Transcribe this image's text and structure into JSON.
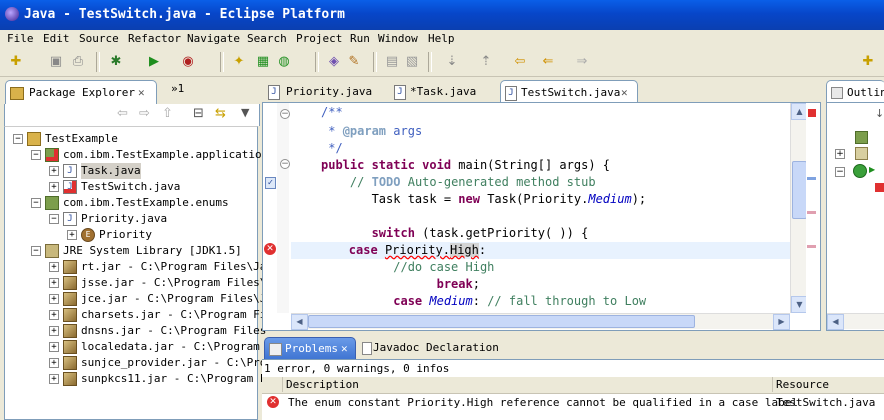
{
  "window": {
    "title": "Java - TestSwitch.java - Eclipse Platform"
  },
  "menu": [
    "File",
    "Edit",
    "Source",
    "Refactor",
    "Navigate",
    "Search",
    "Project",
    "Run",
    "Window",
    "Help"
  ],
  "package_explorer": {
    "tab_label": "Package Explorer",
    "hierarchy_tab": "»1",
    "tree": [
      {
        "label": "TestExample",
        "level": 0,
        "icon": "project-icon",
        "expanded": true
      },
      {
        "label": "com.ibm.TestExample.application",
        "level": 1,
        "icon": "package-error-icon",
        "expanded": true
      },
      {
        "label": "Task.java",
        "level": 2,
        "icon": "java-file-icon",
        "expanded": false
      },
      {
        "label": "TestSwitch.java",
        "level": 2,
        "icon": "java-file-error-icon",
        "expanded": false
      },
      {
        "label": "com.ibm.TestExample.enums",
        "level": 1,
        "icon": "package-icon",
        "expanded": true
      },
      {
        "label": "Priority.java",
        "level": 2,
        "icon": "java-file-icon",
        "expanded": true
      },
      {
        "label": "Priority",
        "level": 3,
        "icon": "enum-icon",
        "expanded": false
      },
      {
        "label": "JRE System Library [JDK1.5]",
        "level": 1,
        "icon": "library-icon",
        "expanded": true
      },
      {
        "label": "rt.jar - C:\\Program Files\\Ja",
        "level": 2,
        "icon": "jar-icon",
        "expanded": false
      },
      {
        "label": "jsse.jar - C:\\Program Files\\",
        "level": 2,
        "icon": "jar-icon",
        "expanded": false
      },
      {
        "label": "jce.jar - C:\\Program Files\\J",
        "level": 2,
        "icon": "jar-icon",
        "expanded": false
      },
      {
        "label": "charsets.jar - C:\\Program Fi",
        "level": 2,
        "icon": "jar-icon",
        "expanded": false
      },
      {
        "label": "dnsns.jar - C:\\Program Files",
        "level": 2,
        "icon": "jar-icon",
        "expanded": false
      },
      {
        "label": "localedata.jar - C:\\Program",
        "level": 2,
        "icon": "jar-icon",
        "expanded": false
      },
      {
        "label": "sunjce_provider.jar - C:\\Pro",
        "level": 2,
        "icon": "jar-icon",
        "expanded": false
      },
      {
        "label": "sunpkcs11.jar - C:\\Program F",
        "level": 2,
        "icon": "jar-icon",
        "expanded": false
      }
    ]
  },
  "editor": {
    "tabs": [
      {
        "label": "Priority.java",
        "active": false
      },
      {
        "label": "*Task.java",
        "active": false
      },
      {
        "label": "TestSwitch.java",
        "active": true
      }
    ]
  },
  "outline": {
    "tab_label": "Outlin"
  },
  "problems": {
    "tabs": [
      {
        "label": "Problems",
        "active": true
      },
      {
        "label": "Javadoc",
        "active": false
      },
      {
        "label": "Declaration",
        "active": false
      }
    ],
    "summary": "1 error, 0 warnings, 0 infos",
    "columns": {
      "description": "Description",
      "resource": "Resource"
    },
    "rows": [
      {
        "description": "The enum constant Priority.High reference cannot be qualified in a case label",
        "resource": "TestSwitch.java"
      }
    ]
  },
  "colors": {
    "title_bar": "#0746c9",
    "error": "#e03030",
    "keyword": "#7f0055",
    "comment": "#3f7f5f"
  }
}
